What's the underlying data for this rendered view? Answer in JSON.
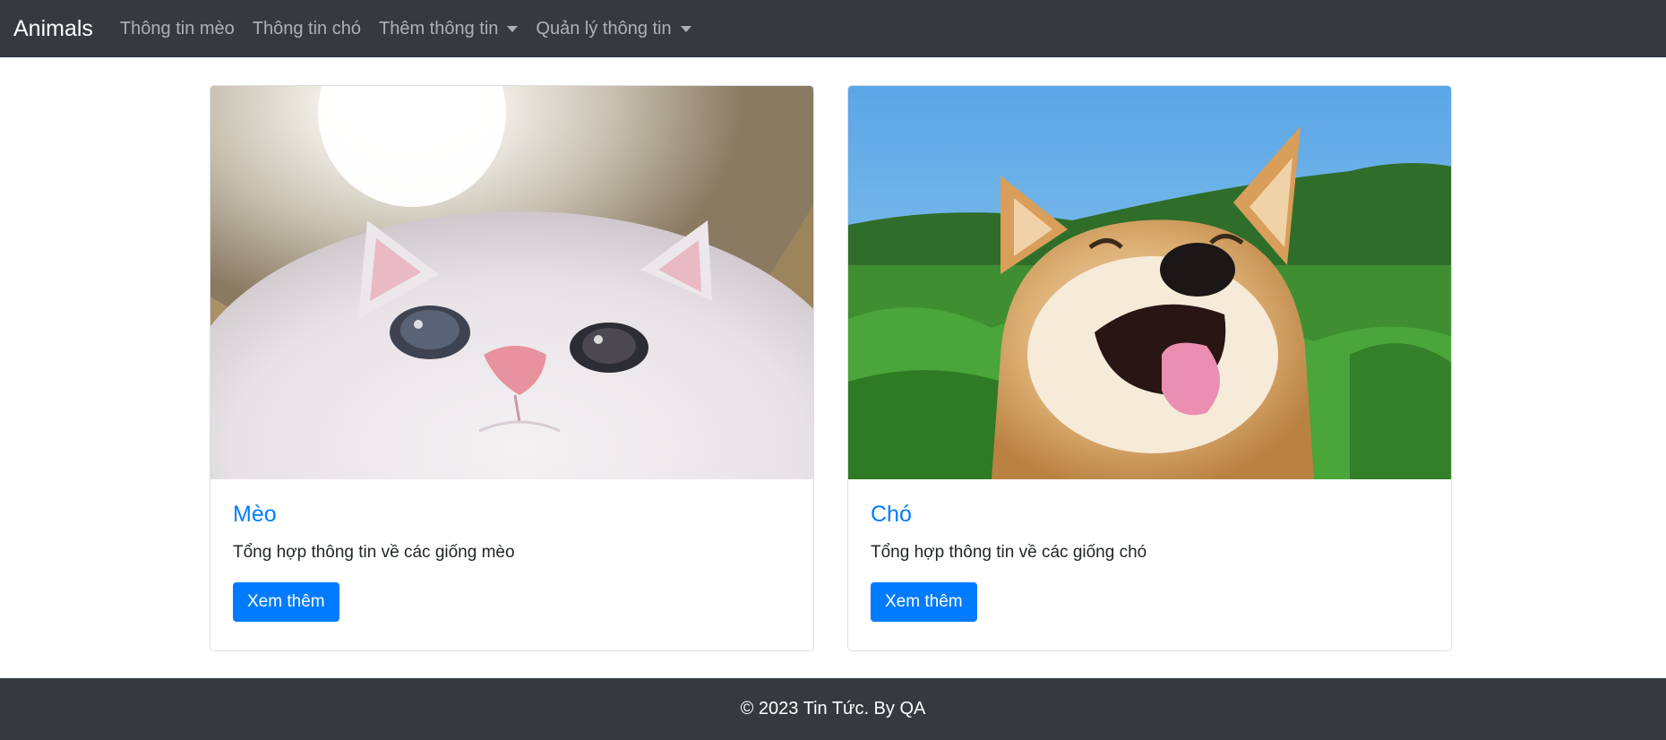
{
  "navbar": {
    "brand": "Animals",
    "links": [
      {
        "label": "Thông tin mèo"
      },
      {
        "label": "Thông tin chó"
      },
      {
        "label": "Thêm thông tin",
        "dropdown": true
      },
      {
        "label": "Quản lý thông tin",
        "dropdown": true
      }
    ]
  },
  "cards": [
    {
      "title": "Mèo",
      "text": "Tổng hợp thông tin về các giống mèo",
      "button": "Xem thêm",
      "image": "cat-photo"
    },
    {
      "title": "Chó",
      "text": "Tổng hợp thông tin về các giống chó",
      "button": "Xem thêm",
      "image": "dog-photo"
    }
  ],
  "footer": {
    "text": "© 2023 Tin Tức. By QA"
  },
  "colors": {
    "navbar_bg": "#343a40",
    "primary": "#007bff",
    "title": "#007bff"
  }
}
